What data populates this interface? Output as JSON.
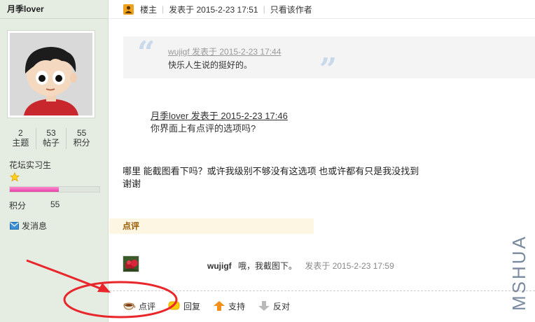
{
  "sidebar": {
    "username": "月季lover",
    "stats": [
      {
        "value": "2",
        "label": "主题"
      },
      {
        "value": "53",
        "label": "帖子"
      },
      {
        "value": "55",
        "label": "积分"
      }
    ],
    "level": "花坛实习生",
    "level_progress": 0.55,
    "points_label": "积分",
    "points_value": "55",
    "send_message": "发消息"
  },
  "post": {
    "op_label": "楼主",
    "posted_at": "发表于 2015-2-23 17:51",
    "only_author": "只看该作者",
    "quote": {
      "meta": "wujigf 发表于 2015-2-23 17:44",
      "text": "快乐人生说的挺好的。"
    },
    "inner_quote": {
      "meta": "月季lover 发表于 2015-2-23 17:46",
      "text": "你界面上有点评的选项吗?"
    },
    "body_line1": "哪里 能截图看下吗？或许我级别不够没有这选项 也或许都有只是我没找到",
    "body_line2": "谢谢",
    "comment_section_title": "点评",
    "comment": {
      "user": "wujigf",
      "text": "哦，我截图下。",
      "time": "发表于 2015-2-23 17:59"
    },
    "actions": {
      "comment": "点评",
      "reply": "回复",
      "support": "支持",
      "oppose": "反对"
    }
  },
  "watermark": "MSHUA",
  "colors": {
    "sidebar_bg": "#e5ede2",
    "level_bar": "#e23ea6",
    "comment_tab_bg": "#fdf6e3",
    "annotation_red": "#e8262b",
    "quote_mark": "#c9d9ec"
  },
  "icons": [
    "avatar-cartoon",
    "star-icon",
    "mail-icon",
    "op-icon",
    "teacup-icon",
    "reply-bubble-icon",
    "up-arrow-icon",
    "down-arrow-icon"
  ]
}
